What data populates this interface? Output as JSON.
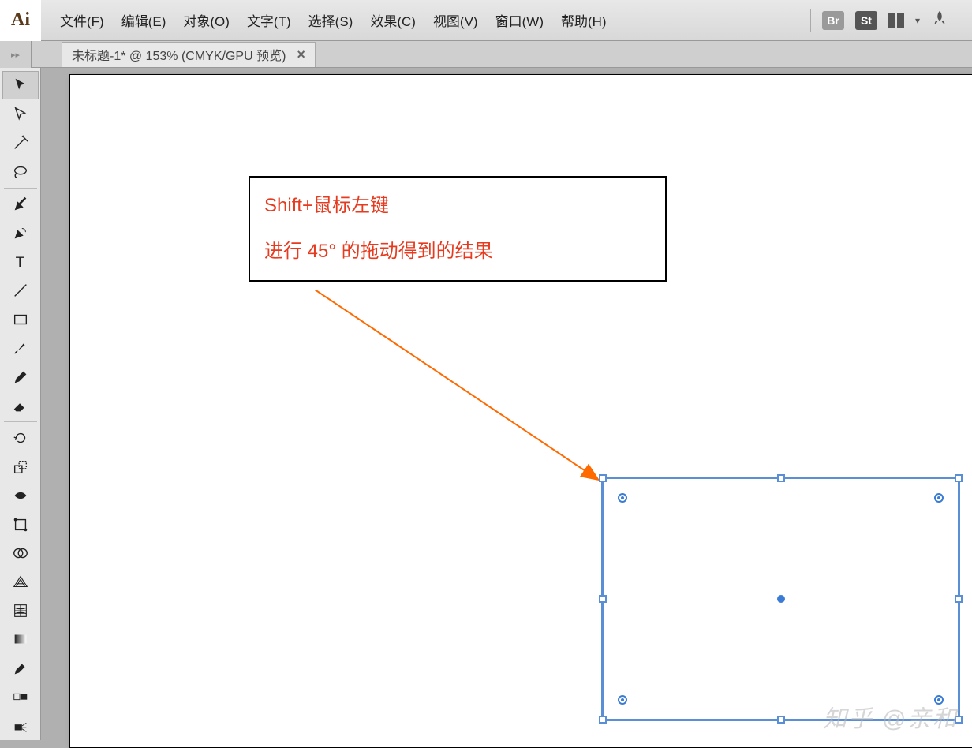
{
  "app": {
    "logo": "Ai"
  },
  "menu": {
    "items": [
      "文件(F)",
      "编辑(E)",
      "对象(O)",
      "文字(T)",
      "选择(S)",
      "效果(C)",
      "视图(V)",
      "窗口(W)",
      "帮助(H)"
    ],
    "br": "Br",
    "st": "St"
  },
  "tab": {
    "title": "未标题-1* @ 153% (CMYK/GPU 预览)",
    "close": "×"
  },
  "annotation": {
    "line1": "Shift+鼠标左键",
    "line2": "进行  45°  的拖动得到的结果"
  },
  "watermark": "知乎  @亲和"
}
